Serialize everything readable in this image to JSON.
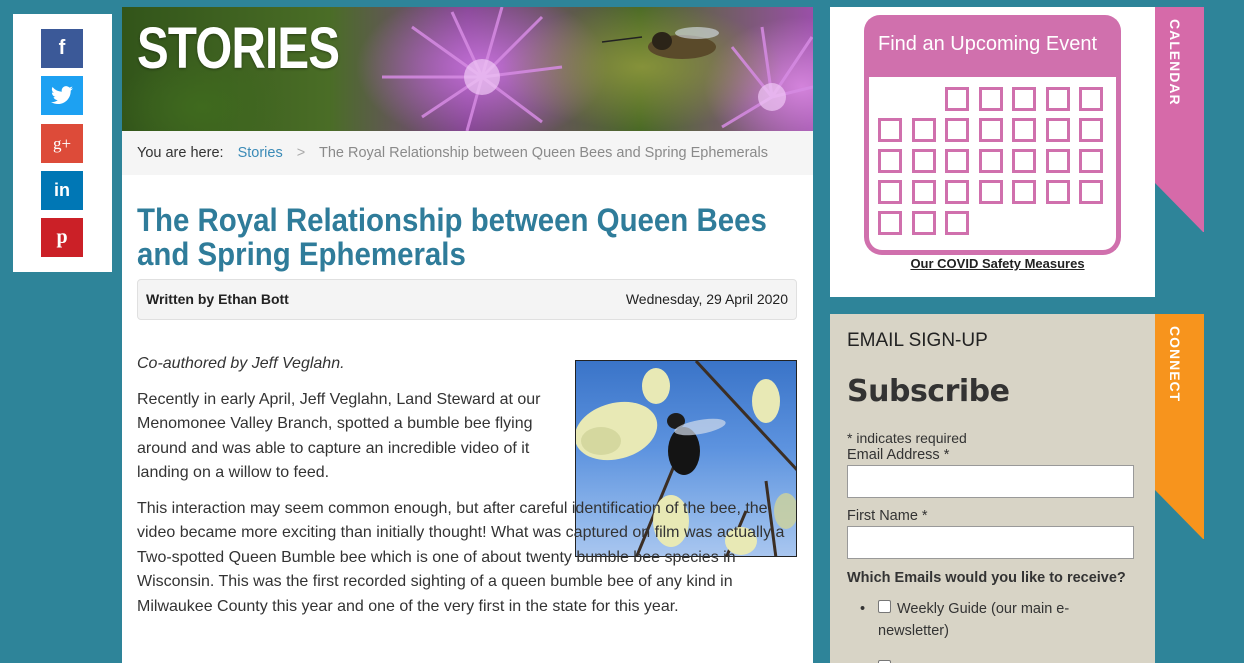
{
  "social": {
    "facebook_glyph": "f",
    "google_glyph": "g+",
    "linkedin_glyph": "in",
    "pinterest_glyph": "p"
  },
  "banner": {
    "title": "STORIES"
  },
  "breadcrumb": {
    "prefix": "You are here:",
    "link": "Stories",
    "separator": ">",
    "current": "The Royal Relationship between Queen Bees and Spring Ephemerals"
  },
  "article": {
    "title": "The Royal Relationship between Queen Bees and Spring Ephemerals",
    "author": "Written by Ethan Bott",
    "date": "Wednesday, 29 April 2020",
    "coauthor": "Co-authored by Jeff Veglahn.",
    "paragraph1": "Recently in early April, Jeff Veglahn, Land Steward at our Menomonee Valley Branch, spotted a bumble bee flying around and was able to capture an incredible video of it landing on a willow to feed.",
    "paragraph2": "This interaction may seem common enough, but after careful identification of the bee, the video became more exciting than initially thought! What was captured on film was actually a Two-spotted Queen Bumble bee which is one of about twenty bumble bee species in Wisconsin. This was the first recorded sighting of a queen bumble bee of any kind in Milwaukee County this year and one of the very first in the state for this year."
  },
  "calendar": {
    "heading": "Find an Upcoming Event",
    "tab_label": "CALENDAR",
    "covid_link": "Our COVID Safety Measures"
  },
  "signup": {
    "tab_label": "CONNECT",
    "heading": "EMAIL SIGN-UP",
    "subscribe": "Subscribe",
    "required_note": "* indicates required",
    "email_label": "Email Address *",
    "email_value": "",
    "firstname_label": "First Name *",
    "firstname_value": "",
    "question": "Which Emails would you like to receive?",
    "option1": "Weekly Guide (our main e-newsletter)"
  },
  "colors": {
    "page_bg": "#2e8499",
    "title_blue": "#2f7c9a",
    "link_blue": "#3b8bb7",
    "calendar_pink": "#d070ad",
    "connect_orange": "#f7941d",
    "signup_bg": "#d8d4c6"
  }
}
